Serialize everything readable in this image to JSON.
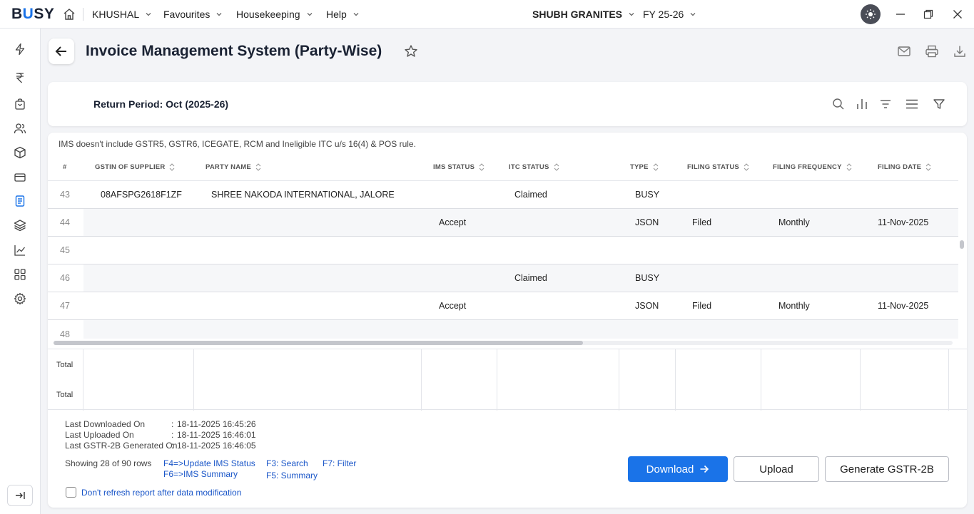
{
  "app": {
    "logo": {
      "pre": "B",
      "mid": "U",
      "post": "SY"
    },
    "menus": [
      "KHUSHAL",
      "Favourites",
      "Housekeeping",
      "Help"
    ],
    "company": "SHUBH GRANITES",
    "fiscal_year": "FY 25-26"
  },
  "sidebar": {
    "icons": [
      "lightning-icon",
      "rupee-icon",
      "bag-icon",
      "users-icon",
      "box-icon",
      "card-icon",
      "document-icon",
      "layers-icon",
      "chart-line-icon",
      "grid-icon",
      "gear-icon"
    ],
    "active": "document-icon"
  },
  "page": {
    "title": "Invoice Management System (Party-Wise)",
    "return_period": "Return Period: Oct (2025-26)"
  },
  "table": {
    "note": "IMS doesn't include GSTR5, GSTR6, ICEGATE, RCM and Ineligible ITC u/s 16(4) & POS rule.",
    "columns": [
      "#",
      "GSTIN OF SUPPLIER",
      "PARTY NAME",
      "IMS STATUS",
      "ITC STATUS",
      "TYPE",
      "FILING STATUS",
      "FILING FREQUENCY",
      "FILING DATE"
    ],
    "rows": [
      {
        "num": "43",
        "gstin": "08AFSPG2618F1ZF",
        "party": "SHREE NAKODA INTERNATIONAL, JALORE",
        "ims": "",
        "itc": "Claimed",
        "type": "BUSY",
        "filing_status": "",
        "frequency": "",
        "date": ""
      },
      {
        "num": "44",
        "gstin": "",
        "party": "",
        "ims": "Accept",
        "itc": "",
        "type": "JSON",
        "filing_status": "Filed",
        "frequency": "Monthly",
        "date": "11-Nov-2025"
      },
      {
        "num": "45",
        "gstin": "",
        "party": "",
        "ims": "",
        "itc": "",
        "type": "",
        "filing_status": "",
        "frequency": "",
        "date": ""
      },
      {
        "num": "46",
        "gstin": "",
        "party": "",
        "ims": "",
        "itc": "Claimed",
        "type": "BUSY",
        "filing_status": "",
        "frequency": "",
        "date": ""
      },
      {
        "num": "47",
        "gstin": "",
        "party": "",
        "ims": "Accept",
        "itc": "",
        "type": "JSON",
        "filing_status": "Filed",
        "frequency": "Monthly",
        "date": "11-Nov-2025"
      },
      {
        "num": "48",
        "gstin": "",
        "party": "",
        "ims": "",
        "itc": "",
        "type": "",
        "filing_status": "",
        "frequency": "",
        "date": ""
      }
    ],
    "totals": [
      "Total",
      "Total"
    ]
  },
  "footer": {
    "meta": [
      {
        "label": "Last Downloaded On",
        "value": "18-11-2025 16:45:26"
      },
      {
        "label": "Last Uploaded On",
        "value": "18-11-2025 16:46:01"
      },
      {
        "label": "Last GSTR-2B Generated On",
        "value": "18-11-2025 16:46:05"
      }
    ],
    "showing": "Showing 28 of 90 rows",
    "shortcuts": {
      "f4": "F4=>Update IMS Status",
      "f6": "F6=>IMS Summary",
      "f3": "F3: Search",
      "f5": "F5: Summary",
      "f7": "F7: Filter"
    },
    "checkbox_label": "Don't refresh report after data modification",
    "buttons": {
      "download": "Download",
      "upload": "Upload",
      "generate": "Generate GSTR-2B"
    }
  },
  "colors": {
    "accent": "#1a73e8",
    "link": "#1a56c8"
  }
}
